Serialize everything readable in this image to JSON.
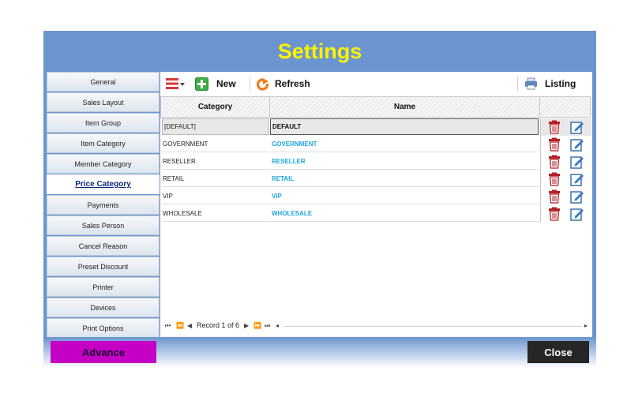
{
  "window": {
    "title": "Settings"
  },
  "sidebar": {
    "items": [
      {
        "label": "General"
      },
      {
        "label": "Sales Layout"
      },
      {
        "label": "Item Group"
      },
      {
        "label": "Item Category"
      },
      {
        "label": "Member Category"
      },
      {
        "label": "Price Category",
        "active": true
      },
      {
        "label": "Payments"
      },
      {
        "label": "Sales Person"
      },
      {
        "label": "Cancel Reason"
      },
      {
        "label": "Preset Discount"
      },
      {
        "label": "Printer"
      },
      {
        "label": "Devices"
      },
      {
        "label": "Print Options"
      }
    ]
  },
  "toolbar": {
    "new_label": "New",
    "refresh_label": "Refresh",
    "listing_label": "Listing"
  },
  "grid": {
    "columns": [
      "Category",
      "Name"
    ],
    "rows": [
      {
        "category": "[DEFAULT]",
        "name": "DEFAULT"
      },
      {
        "category": "GOVERNMENT",
        "name": "GOVERNMENT"
      },
      {
        "category": "RESELLER",
        "name": "RESELLER"
      },
      {
        "category": "RETAIL",
        "name": "RETAIL"
      },
      {
        "category": "VIP",
        "name": "VIP"
      },
      {
        "category": "WHOLESALE",
        "name": "WHOLESALE"
      }
    ],
    "record_text": "Record 1 of 6"
  },
  "footer": {
    "advance_label": "Advance",
    "close_label": "Close"
  },
  "colors": {
    "title": "#fff200",
    "window_bg": "#6b95cf",
    "name_text": "#1ea7e0",
    "advance_bg": "#c400c4"
  }
}
